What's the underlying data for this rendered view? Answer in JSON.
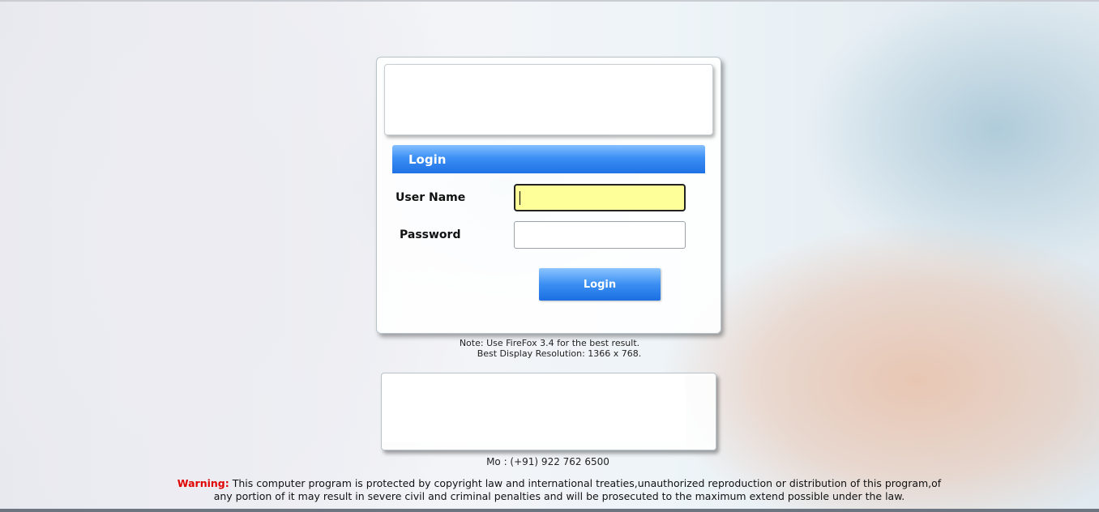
{
  "login": {
    "header": "Login",
    "username_label": "User Name",
    "username_value": "",
    "password_label": "Password",
    "password_value": "",
    "button_label": "Login"
  },
  "note": {
    "line1": "Note: Use FireFox 3.4 for the best result.",
    "line2": "Best Display Resolution: 1366 x 768."
  },
  "contact": "Mo : (+91) 922 762 6500",
  "warning": {
    "label": "Warning:",
    "line1": "This computer program is protected by copyright law and international treaties,unauthorized reproduction or distribution of this program,of",
    "line2": "any portion of it may result in severe civil and criminal penalties and will be prosecuted to the maximum extend possible under the law."
  },
  "colors": {
    "accent_blue": "#1f72e4",
    "input_highlight": "#ffff99",
    "warning_red": "#e00000"
  }
}
